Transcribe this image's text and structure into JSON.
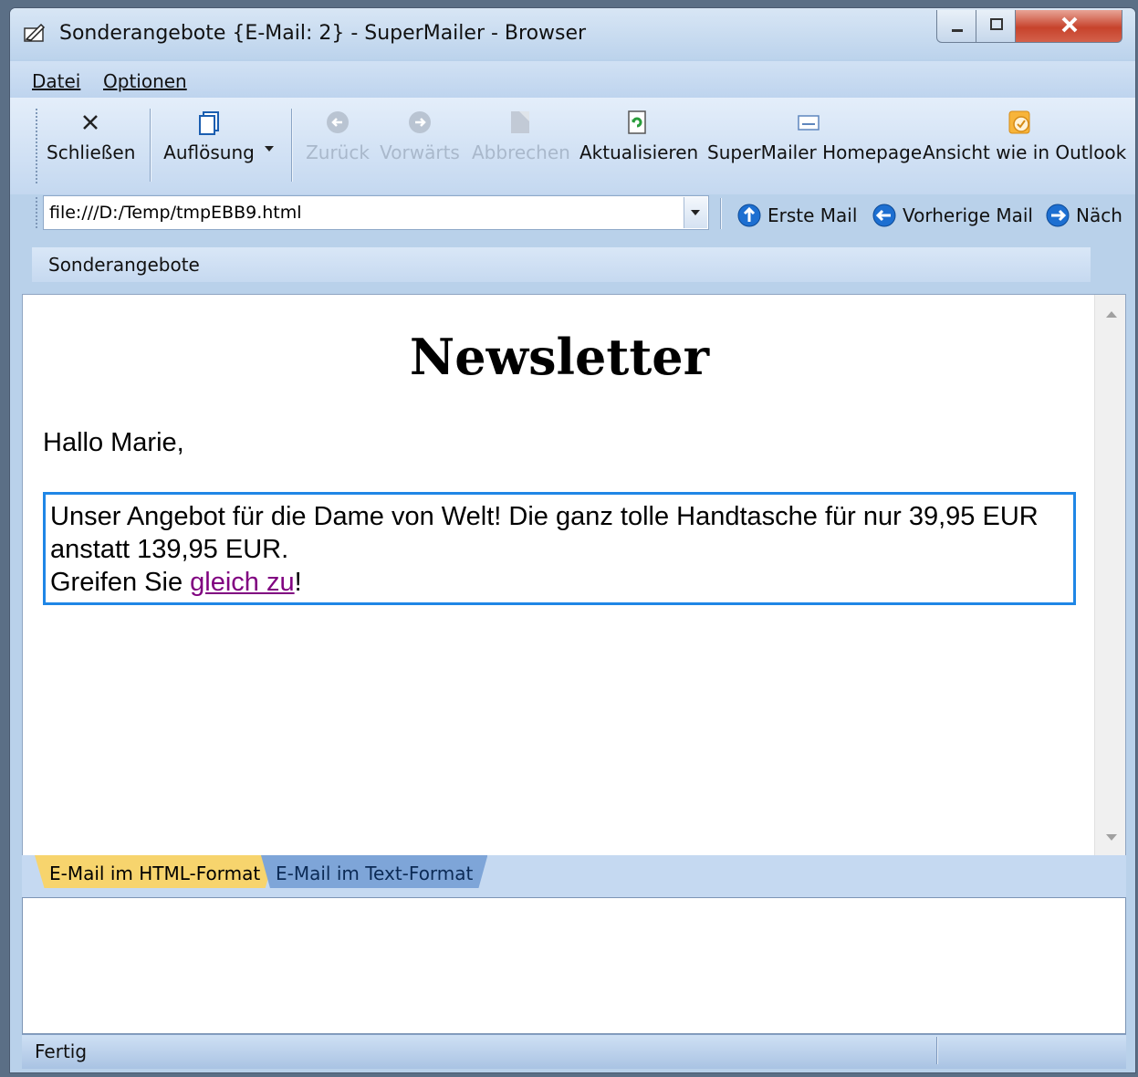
{
  "window": {
    "title": "Sonderangebote {E-Mail: 2} - SuperMailer - Browser"
  },
  "menu": [
    {
      "label": "Datei"
    },
    {
      "label": "Optionen"
    }
  ],
  "toolbar": {
    "close": "Schließen",
    "resolution": "Auflösung",
    "back": "Zurück",
    "forward": "Vorwärts",
    "cancel": "Abbrechen",
    "refresh": "Aktualisieren",
    "homepage": "SuperMailer Homepage",
    "outlook_view": "Ansicht wie in Outlook"
  },
  "address": {
    "value": "file:///D:/Temp/tmpEBB9.html"
  },
  "mail_nav": {
    "first": "Erste Mail",
    "previous": "Vorherige Mail",
    "next": "Näch"
  },
  "linkbar": {
    "label": "Sonderangebote"
  },
  "newsletter": {
    "title": "Newsletter",
    "greeting": "Hallo Marie,",
    "offer_text": "Unser Angebot für die Dame von Welt! Die ganz tolle Handtasche für nur 39,95 EUR anstatt 139,95 EUR.",
    "cta_prefix": "Greifen Sie ",
    "cta_link": "gleich zu",
    "cta_suffix": "!"
  },
  "tabs": [
    {
      "label": "E-Mail im HTML-Format",
      "active": true
    },
    {
      "label": "E-Mail im Text-Format",
      "active": false
    }
  ],
  "status": {
    "text": "Fertig"
  },
  "colors": {
    "accent_border": "#1f86e6",
    "visited_link": "#800080",
    "active_tab": "#f7d46d"
  }
}
